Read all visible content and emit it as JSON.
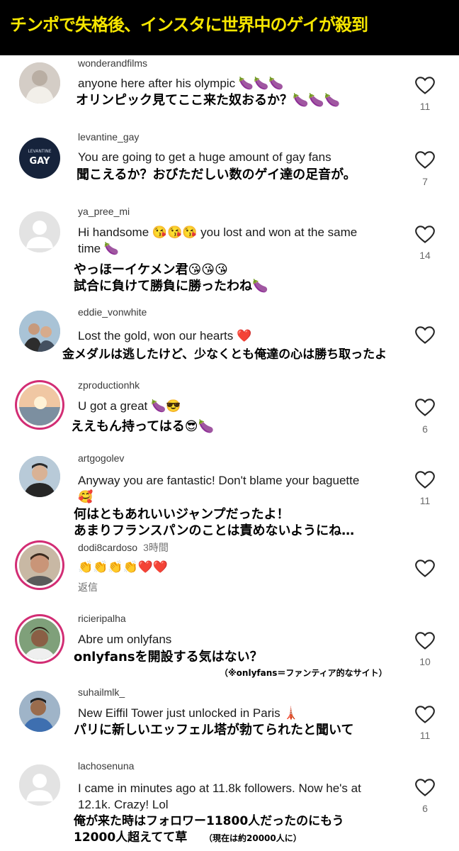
{
  "banner": {
    "title": "チンポで失格後、インスタに世界中のゲイが殺到"
  },
  "comments": [
    {
      "username": "wonderandfilms",
      "time": "",
      "text": "anyone here after his olympic 🍆🍆🍆",
      "jp": "オリンピック見てここ来た奴おるか？🍆🍆🍆",
      "likes": "11",
      "avatar": "user-photo"
    },
    {
      "username": "levantine_gay",
      "time": "",
      "text": "You are going to get a huge amount of gay fans",
      "jp": "聞こえるか？おびただしい数のゲイ達の足音が。",
      "likes": "7",
      "avatar": "levantine-gay-logo",
      "avatar_text_small": "LEVANTINE",
      "avatar_text_big": "GAY"
    },
    {
      "username": "ya_pree_mi",
      "time": "",
      "text": "Hi handsome 😘😘😘 you lost and won at the same time 🍆",
      "jp": "やっほーイケメン君😘😘😘\n試合に負けて勝負に勝ったわね🍆",
      "likes": "14",
      "avatar": "default-avatar"
    },
    {
      "username": "eddie_vonwhite",
      "time": "",
      "text": "Lost the gold, won our hearts ❤️",
      "jp": "金メダルは逃したけど、少なくとも俺達の心は勝ち取ったよ",
      "likes": "",
      "avatar": "couple-photo"
    },
    {
      "username": "zproductionhk",
      "time": "",
      "text": "U got a great 🍆😎",
      "jp": "ええもん持ってはる😎🍆",
      "likes": "6",
      "avatar": "sunset-photo"
    },
    {
      "username": "artgogolev",
      "time": "",
      "text": "Anyway you are fantastic! Don't blame your baguette 🥰",
      "jp": "何はともあれいいジャンプだったよ！\nあまりフランスパンのことは責めないようにね…",
      "likes": "11",
      "avatar": "man-photo"
    },
    {
      "username": "dodi8cardoso",
      "time": "3時間",
      "text": "👏👏👏👏❤️❤️",
      "jp": "",
      "likes": "",
      "reply": "返信",
      "avatar": "man-photo"
    },
    {
      "username": "ricieripalha",
      "time": "",
      "text": "Abre um onlyfans",
      "jp": "onlyfansを開設する気はない？",
      "note": "（※onlyfans＝ファンティア的なサイト）",
      "likes": "10",
      "avatar": "man-photo"
    },
    {
      "username": "suhailmlk_",
      "time": "",
      "text": "New Eiffil Tower just unlocked in Paris 🗼",
      "jp": "パリに新しいエッフェル塔が勃てられたと聞いて",
      "likes": "11",
      "avatar": "man-photo"
    },
    {
      "username": "lachosenuna",
      "time": "",
      "text": "I came in minutes ago at 11.8k followers. Now he's at 12.1k. Crazy! Lol",
      "jp": "俺が来た時はフォロワー11800人だったのにもう\n12000人超えてて草",
      "note": "（現在は約20000人に）",
      "likes": "6",
      "avatar": "default-avatar"
    }
  ],
  "colors": {
    "banner_bg": "#000000",
    "banner_text": "#f6e600",
    "story_ring": "#d22d74"
  }
}
